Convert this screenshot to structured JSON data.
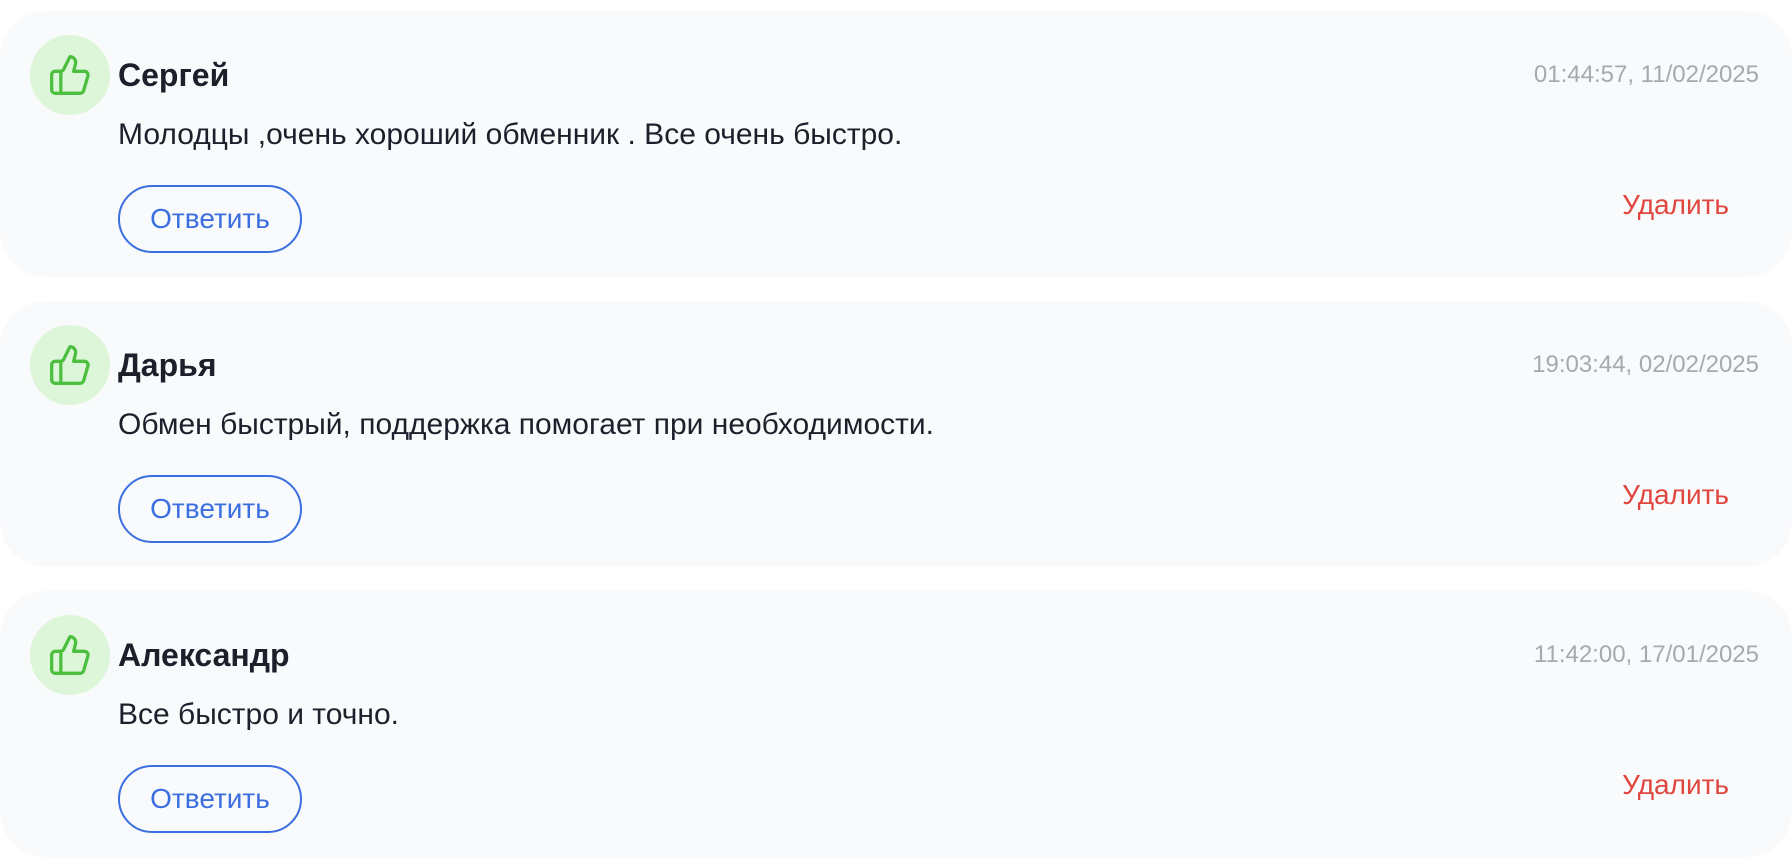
{
  "colors": {
    "card_background": "#f8fafc",
    "avatar_background": "#ddf5d8",
    "like_icon": "#4cbf3e",
    "accent_blue": "#3b6fe0",
    "delete_red": "#e0463e",
    "timestamp_gray": "#a6a9ae",
    "text_dark": "#1e1f2b"
  },
  "reviews": [
    {
      "icon": "thumbs-up-icon",
      "author": "Сергей",
      "timestamp": "01:44:57, 11/02/2025",
      "text": "Молодцы ,очень хороший обменник . Все очень быстро.",
      "reply_label": "Ответить",
      "delete_label": "Удалить"
    },
    {
      "icon": "thumbs-up-icon",
      "author": "Дарья",
      "timestamp": "19:03:44, 02/02/2025",
      "text": "Обмен быстрый, поддержка помогает при необходимости.",
      "reply_label": "Ответить",
      "delete_label": "Удалить"
    },
    {
      "icon": "thumbs-up-icon",
      "author": "Александр",
      "timestamp": "11:42:00, 17/01/2025",
      "text": "Все быстро и точно.",
      "reply_label": "Ответить",
      "delete_label": "Удалить"
    }
  ]
}
